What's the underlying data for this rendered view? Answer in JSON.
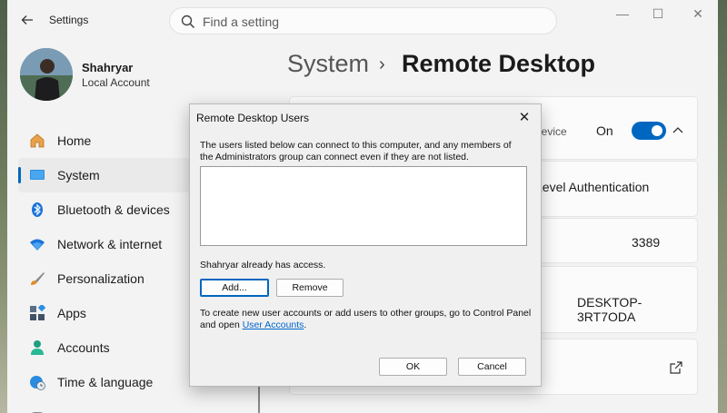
{
  "app": {
    "title": "Settings"
  },
  "search": {
    "placeholder": "Find a setting"
  },
  "window_controls": {
    "minimize": "—",
    "maximize": "☐",
    "close": "✕"
  },
  "profile": {
    "name": "Shahryar",
    "account_type": "Local Account"
  },
  "nav": {
    "items": [
      {
        "label": "Home",
        "icon": "home-icon"
      },
      {
        "label": "System",
        "icon": "system-icon",
        "active": true
      },
      {
        "label": "Bluetooth & devices",
        "icon": "bluetooth-icon"
      },
      {
        "label": "Network & internet",
        "icon": "wifi-icon"
      },
      {
        "label": "Personalization",
        "icon": "brush-icon"
      },
      {
        "label": "Apps",
        "icon": "apps-icon"
      },
      {
        "label": "Accounts",
        "icon": "person-icon"
      },
      {
        "label": "Time & language",
        "icon": "globe-clock-icon"
      }
    ]
  },
  "breadcrumb": {
    "parent": "System",
    "separator": "›",
    "current": "Remote Desktop"
  },
  "cards": {
    "remote_desktop": {
      "label_fragment": "device",
      "state": "On",
      "expanded": true
    },
    "nla": {
      "label_fragment": "Level Authentication"
    },
    "port": {
      "value": "3389"
    },
    "pc_name": {
      "value": "DESKTOP-3RT7ODA"
    }
  },
  "dialog": {
    "title": "Remote Desktop Users",
    "description": "The users listed below can connect to this computer, and any members of the Administrators group can connect even if they are not listed.",
    "users": [],
    "access_note": "Shahryar already has access.",
    "add_label": "Add...",
    "remove_label": "Remove",
    "footer_text": "To create new user accounts or add users to other groups, go to Control Panel and open",
    "footer_link": "User Accounts",
    "footer_end": ".",
    "ok_label": "OK",
    "cancel_label": "Cancel"
  },
  "colors": {
    "accent": "#0067c0",
    "link": "#0066cc",
    "window_bg": "#f3f3f3"
  }
}
